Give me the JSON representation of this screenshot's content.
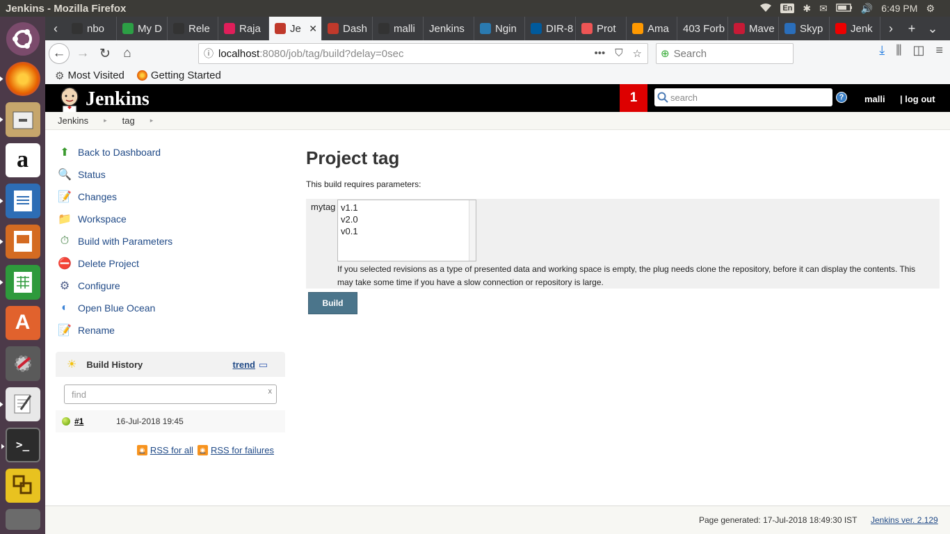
{
  "system": {
    "window_title": "Jenkins - Mozilla Firefox",
    "keyboard": "En",
    "clock": "6:49 PM"
  },
  "launcher": {
    "items": [
      "ubuntu-dash-icon",
      "firefox-icon",
      "files-icon",
      "amazon-icon",
      "writer-icon",
      "impress-icon",
      "calc-icon",
      "software-center-icon",
      "system-settings-icon",
      "text-editor-icon",
      "terminal-icon",
      "vmware-icon",
      "trash-icon"
    ]
  },
  "tabs": [
    {
      "label": "nbo",
      "icon": "github-icon",
      "color": "#333"
    },
    {
      "label": "My D",
      "icon": "drive-icon",
      "color": "#2c9f45"
    },
    {
      "label": "Rele",
      "icon": "github-icon",
      "color": "#333"
    },
    {
      "label": "Raja",
      "icon": "slack-icon",
      "color": "#e01e5a"
    },
    {
      "label": "Je",
      "icon": "jenkins-icon",
      "color": "#c0392b",
      "active": true
    },
    {
      "label": "Dash",
      "icon": "jenkins-icon",
      "color": "#c0392b"
    },
    {
      "label": "malli",
      "icon": "github-icon",
      "color": "#333"
    },
    {
      "label": "Jenkins",
      "icon": "",
      "color": ""
    },
    {
      "label": "Ngin",
      "icon": "r-icon",
      "color": "#2a7ab0"
    },
    {
      "label": "DIR-8",
      "icon": "d-icon",
      "color": "#005a9c"
    },
    {
      "label": "Prot",
      "icon": "proto-icon",
      "color": "#e55"
    },
    {
      "label": "Ama",
      "icon": "aws-icon",
      "color": "#f90"
    },
    {
      "label": "403 Forb",
      "icon": "",
      "color": ""
    },
    {
      "label": "Mave",
      "icon": "maven-icon",
      "color": "#c71a36"
    },
    {
      "label": "Skyp",
      "icon": "skype-icon",
      "color": "#2a6ebb"
    },
    {
      "label": "Jenk",
      "icon": "youtube-icon",
      "color": "#e00"
    }
  ],
  "url": {
    "host": "localhost",
    "rest": ":8080/job/tag/build?delay=0sec"
  },
  "browser_search": {
    "placeholder": "Search"
  },
  "bookmarks": [
    {
      "label": "Most Visited",
      "icon": "gear-icon"
    },
    {
      "label": "Getting Started",
      "icon": "firefox-icon"
    }
  ],
  "jenkins": {
    "brand": "Jenkins",
    "notifications": "1",
    "search_placeholder": "search",
    "help": "?",
    "user": "malli",
    "logout": "| log out"
  },
  "breadcrumbs": [
    "Jenkins",
    "tag"
  ],
  "tasks": [
    {
      "label": "Back to Dashboard",
      "icon": "up-arrow-icon",
      "glyph": "⬆",
      "color": "#3a9a2e"
    },
    {
      "label": "Status",
      "icon": "magnifier-icon",
      "glyph": "🔍",
      "color": "#4a6fa5"
    },
    {
      "label": "Changes",
      "icon": "notepad-icon",
      "glyph": "📝",
      "color": "#b08a3c"
    },
    {
      "label": "Workspace",
      "icon": "folder-icon",
      "glyph": "📁",
      "color": "#4a82c2"
    },
    {
      "label": "Build with Parameters",
      "icon": "clock-icon",
      "glyph": "⏱",
      "color": "#3a7a3a"
    },
    {
      "label": "Delete Project",
      "icon": "no-entry-icon",
      "glyph": "⛔",
      "color": "#c0262c"
    },
    {
      "label": "Configure",
      "icon": "gear-icon",
      "glyph": "⚙",
      "color": "#4f5f8a"
    },
    {
      "label": "Open Blue Ocean",
      "icon": "blue-ocean-icon",
      "glyph": "◐",
      "color": "#3d84d6"
    },
    {
      "label": "Rename",
      "icon": "notepad-icon",
      "glyph": "📝",
      "color": "#b08a3c"
    }
  ],
  "build_history": {
    "title": "Build History",
    "trend": "trend",
    "find_placeholder": "find",
    "find_clear": "x",
    "builds": [
      {
        "number": "#1",
        "date": "16-Jul-2018 19:45",
        "status": "success"
      }
    ],
    "rss_all": "RSS for all",
    "rss_failures": "RSS for failures"
  },
  "main": {
    "title": "Project tag",
    "requires": "This build requires parameters:",
    "param_name": "mytag",
    "param_options": [
      "v1.1",
      "v2.0",
      "v0.1"
    ],
    "param_description": "If you selected revisions as a type of presented data and working space is empty, the plug needs clone the repository, before it can display the contents. This may take some time if you have a slow connection or repository is large.",
    "build_button": "Build"
  },
  "footer": {
    "generated": "Page generated: 17-Jul-2018 18:49:30 IST",
    "version": "Jenkins ver. 2.129"
  }
}
